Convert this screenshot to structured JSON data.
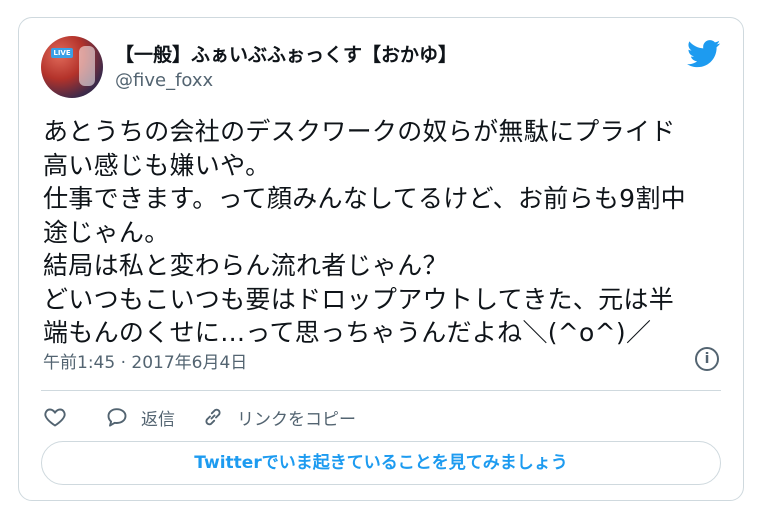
{
  "tweet": {
    "display_name": "【一般】ふぁいぶふぉっくす【おかゆ】",
    "handle": "@five_foxx",
    "avatar_badge": "LIVE",
    "body": "あとうちの会社のデスクワークの奴らが無駄にプライド\n高い感じも嫌いや。\n仕事できます。って顔みんなしてるけど、お前らも9割中\n途じゃん。\n結局は私と変わらん流れ者じゃん？\nどいつもこいつも要はドロップアウトしてきた、元は半\n端もんのくせに…って思っちゃうんだよね＼(^o^)／",
    "timestamp": "午前1:45 · 2017年6月4日",
    "info_glyph": "i"
  },
  "actions": {
    "like_label": "",
    "reply_label": "返信",
    "copy_link_label": "リンクをコピー"
  },
  "cta": {
    "label": "Twitterでいま起きていることを見てみましょう"
  },
  "colors": {
    "accent": "#1d9bf0",
    "muted": "#536471",
    "border": "#cfd9de"
  },
  "icons": [
    "twitter-bird-icon",
    "info-icon",
    "heart-icon",
    "reply-bubble-icon",
    "link-icon"
  ]
}
